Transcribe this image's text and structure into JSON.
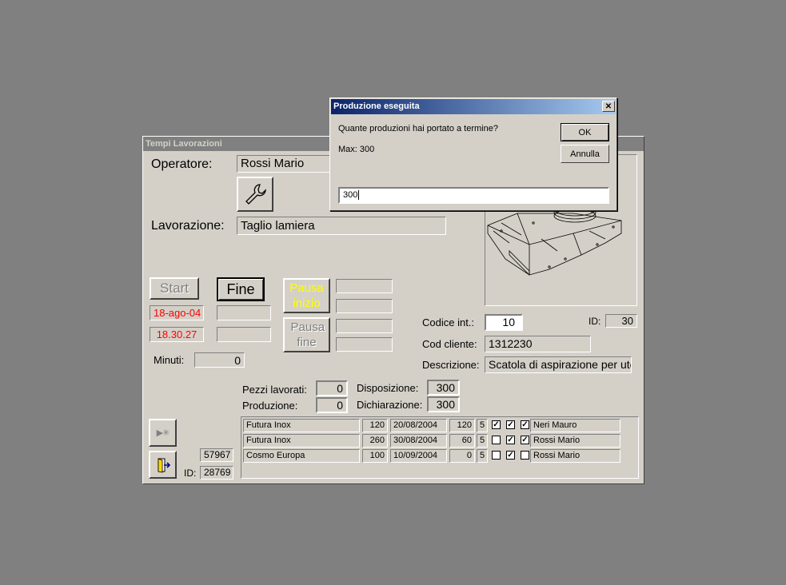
{
  "main_window": {
    "title": "Tempi Lavorazioni",
    "operatore_label": "Operatore:",
    "operatore_value": "Rossi Mario",
    "lavorazione_label": "Lavorazione:",
    "lavorazione_value": "Taglio lamiera",
    "start_label": "Start",
    "fine_label": "Fine",
    "pausa_inizio_label": "Pausa inizio",
    "pausa_fine_label": "Pausa fine",
    "start_date": "18-ago-04",
    "start_time": "18.30.27",
    "minuti_label": "Minuti:",
    "minuti_value": "0",
    "codice_int_label": "Codice  int.:",
    "codice_int_value": "10",
    "id_label": "ID:",
    "id_value": "30",
    "cod_cliente_label": "Cod cliente:",
    "cod_cliente_value": "1312230",
    "descrizione_label": "Descrizione:",
    "descrizione_value": "Scatola di aspirazione per uten",
    "pezzi_lavorati_label": "Pezzi lavorati:",
    "pezzi_lavorati_value": "0",
    "produzione_label": "Produzione:",
    "produzione_value": "0",
    "disposizione_label": "Disposizione:",
    "disposizione_value": "300",
    "dichiarazione_label": "Dichiarazione:",
    "dichiarazione_value": "300",
    "counter_value": "57967",
    "bottom_id_label": "ID:",
    "bottom_id_value": "28769",
    "icons": [
      "wrench-icon",
      "record-nav-icon",
      "exit-door-icon"
    ]
  },
  "orders": [
    {
      "cliente": "Futura Inox",
      "qty": "120",
      "data": "20/08/2004",
      "qty2": "120",
      "n": "5",
      "c1": true,
      "c2": true,
      "c3": true,
      "operatore": "Neri Mauro"
    },
    {
      "cliente": "Futura Inox",
      "qty": "260",
      "data": "30/08/2004",
      "qty2": "60",
      "n": "5",
      "c1": false,
      "c2": true,
      "c3": true,
      "operatore": "Rossi Mario"
    },
    {
      "cliente": "Cosmo Europa",
      "qty": "100",
      "data": "10/09/2004",
      "qty2": "0",
      "n": "5",
      "c1": false,
      "c2": true,
      "c3": false,
      "operatore": "Rossi Mario"
    }
  ],
  "dialog": {
    "title": "Produzione eseguita",
    "prompt": "Quante produzioni hai portato a termine?",
    "max_text": "Max:  300",
    "ok_label": "OK",
    "annulla_label": "Annulla",
    "input_value": "300",
    "close_symbol": "✕"
  },
  "colors": {
    "red_text": "#ff0000",
    "pausa_inizio_text": "#ffff00",
    "title_active": "#0a246a"
  }
}
